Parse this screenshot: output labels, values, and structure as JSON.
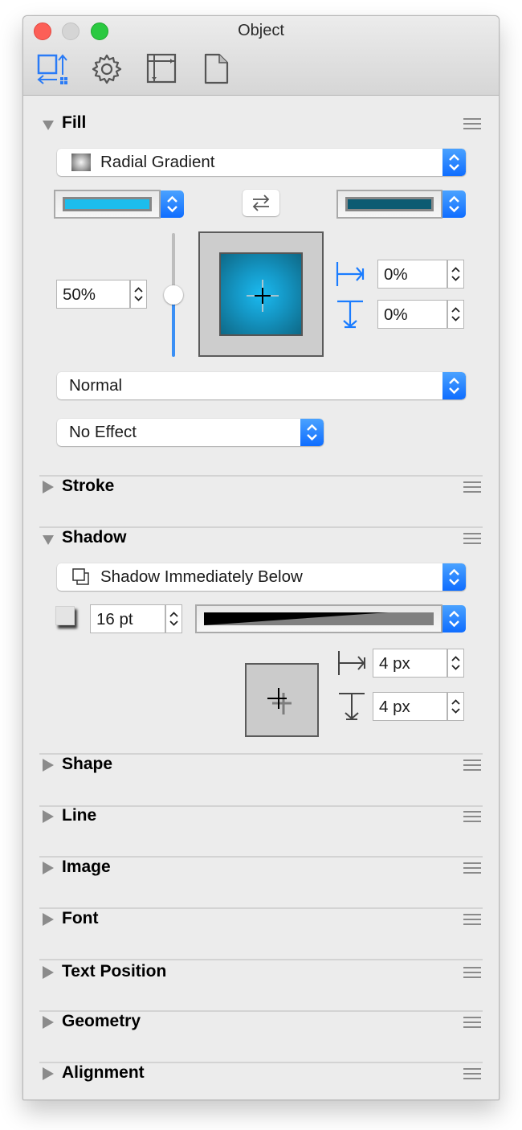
{
  "window": {
    "title": "Object",
    "toolbar": [
      {
        "name": "object-inspector",
        "icon": "object-inspector-icon",
        "active": true
      },
      {
        "name": "properties",
        "icon": "gear-icon",
        "active": false
      },
      {
        "name": "canvas-inspector",
        "icon": "canvas-icon",
        "active": false
      },
      {
        "name": "document-inspector",
        "icon": "document-icon",
        "active": false
      }
    ]
  },
  "fill": {
    "title": "Fill",
    "expanded": true,
    "fill_type": "Radial Gradient",
    "color_start": "#1dbdec",
    "color_end": "#0d5b72",
    "swap_icon": "swap-arrows-icon",
    "midpoint": "50%",
    "midpoint_fraction": 0.5,
    "offset_x": "0%",
    "offset_y": "0%",
    "blend_mode": "Normal",
    "effect": "No Effect"
  },
  "stroke": {
    "title": "Stroke",
    "expanded": false
  },
  "shadow": {
    "title": "Shadow",
    "expanded": true,
    "placement": "Shadow Immediately Below",
    "blur": "16 pt",
    "offset_x": "4 px",
    "offset_y": "4 px"
  },
  "collapsed_sections": [
    {
      "title": "Shape"
    },
    {
      "title": "Line"
    },
    {
      "title": "Image"
    },
    {
      "title": "Font"
    },
    {
      "title": "Text Position"
    },
    {
      "title": "Geometry"
    },
    {
      "title": "Alignment"
    }
  ],
  "colors": {
    "accent": "#1a7cff",
    "panel_bg": "#ececec"
  }
}
